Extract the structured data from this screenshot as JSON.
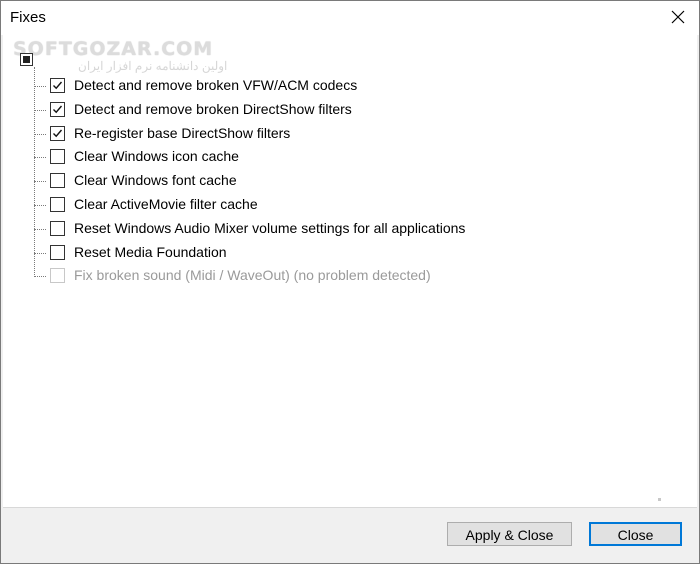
{
  "window": {
    "title": "Fixes",
    "close_icon": "close-x-icon"
  },
  "watermark": {
    "text": "SOFTGOZAR.COM",
    "subtext": "اولین دانشنامه نرم افزار ایران"
  },
  "tree": {
    "root": {
      "state": "indeterminate"
    },
    "items": [
      {
        "label": "Detect and remove broken VFW/ACM codecs",
        "checked": true,
        "enabled": true
      },
      {
        "label": "Detect and remove broken DirectShow filters",
        "checked": true,
        "enabled": true
      },
      {
        "label": "Re-register base DirectShow filters",
        "checked": true,
        "enabled": true
      },
      {
        "label": "Clear Windows icon cache",
        "checked": false,
        "enabled": true
      },
      {
        "label": "Clear Windows font cache",
        "checked": false,
        "enabled": true
      },
      {
        "label": "Clear ActiveMovie filter cache",
        "checked": false,
        "enabled": true
      },
      {
        "label": "Reset Windows Audio Mixer volume settings for all applications",
        "checked": false,
        "enabled": true
      },
      {
        "label": "Reset Media Foundation",
        "checked": false,
        "enabled": true
      },
      {
        "label": "Fix broken sound (Midi / WaveOut)  (no problem detected)",
        "checked": false,
        "enabled": false
      }
    ]
  },
  "buttons": {
    "apply_close": "Apply & Close",
    "close": "Close"
  },
  "colors": {
    "focus_border": "#0078d7",
    "disabled_text": "#9a9a9a"
  }
}
